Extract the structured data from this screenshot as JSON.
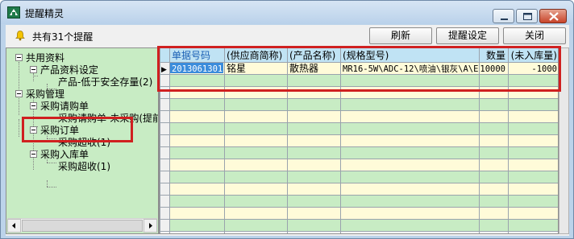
{
  "window": {
    "title": "提醒精灵",
    "app_icon": "app-logo-icon",
    "minimize_icon": "minimize-icon",
    "maximize_icon": "maximize-icon",
    "close_icon": "close-icon"
  },
  "toolbar": {
    "bell_icon": "bell-icon",
    "reminder_count": "共有31个提醒",
    "refresh_label": "刷新",
    "settings_label": "提醒设定",
    "close_label": "关闭"
  },
  "tree": {
    "nodes": [
      {
        "label": "共用资料"
      },
      {
        "label": "产品资料设定"
      },
      {
        "label": "产品-低于安全存量(2)"
      },
      {
        "label": "采购管理"
      },
      {
        "label": "采购请购单"
      },
      {
        "label": "采购请购单-未采购(提前"
      },
      {
        "label": "采购订单"
      },
      {
        "label": "采购超收(1)"
      },
      {
        "label": "采购入库单"
      },
      {
        "label": "采购超收(1)"
      }
    ]
  },
  "grid": {
    "columns": [
      "单据号码",
      "(供应商简称)",
      "(产品名称)",
      "(规格型号)",
      "数量",
      "(未入库量)"
    ],
    "rows": [
      [
        "2013061301",
        "铭星",
        "散热器",
        "MR16-5W\\ADC-12\\喷油\\银灰\\A\\E",
        "10000",
        "-1000"
      ]
    ],
    "current_row_marker": "▶"
  },
  "colors": {
    "tree_bg": "#c8ecc4",
    "grid_header_bg": "#c0e3f4",
    "grid_row_cream": "#fffbd9",
    "grid_row_green": "#c8ecc4",
    "grid_selected_cell": "#3b8cdb",
    "highlight_box": "#d02020"
  }
}
